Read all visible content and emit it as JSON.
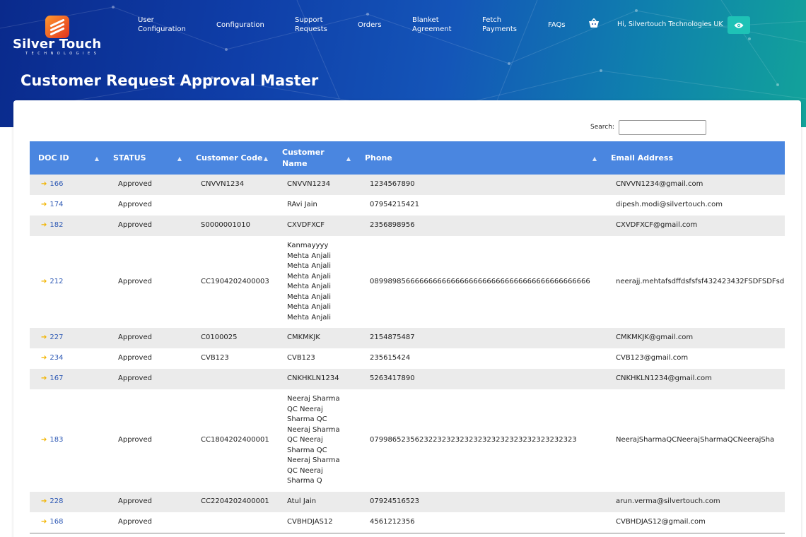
{
  "brand": {
    "name": "Silver Touch",
    "tagline": "TECHNOLOGIES"
  },
  "nav": [
    {
      "line1": "User",
      "line2": "Configuration"
    },
    {
      "line1": "Configuration",
      "line2": ""
    },
    {
      "line1": "Support",
      "line2": "Requests"
    },
    {
      "line1": "Orders",
      "line2": ""
    },
    {
      "line1": "Blanket",
      "line2": "Agreement"
    },
    {
      "line1": "Fetch",
      "line2": "Payments"
    },
    {
      "line1": "FAQs",
      "line2": ""
    }
  ],
  "icons": {
    "cart": "basket-icon",
    "view": "eye-icon",
    "sort": "sort-icon",
    "row_link": "arrow-right-icon"
  },
  "greeting": "Hi, Silvertouch Technologies UK",
  "page_title": "Customer Request Approval Master",
  "search": {
    "label": "Search:",
    "value": ""
  },
  "colors": {
    "header_bg": "#4a86e0",
    "accent": "#1ec2b6",
    "arrow": "#f2b400",
    "link": "#2f5ab5"
  },
  "table": {
    "columns": [
      {
        "label_line1": "DOC ID",
        "label_line2": ""
      },
      {
        "label_line1": "STATUS",
        "label_line2": ""
      },
      {
        "label_line1": "Customer Code",
        "label_line2": ""
      },
      {
        "label_line1": "Customer",
        "label_line2": "Name"
      },
      {
        "label_line1": "Phone",
        "label_line2": ""
      },
      {
        "label_line1": "Email Address",
        "label_line2": ""
      }
    ],
    "rows": [
      {
        "doc_id": "166",
        "status": "Approved",
        "code": "CNVVN1234",
        "name_lines": [
          "CNVVN1234"
        ],
        "phone": "1234567890",
        "email": "CNVVN1234@gmail.com"
      },
      {
        "doc_id": "174",
        "status": "Approved",
        "code": "",
        "name_lines": [
          "RAvi Jain"
        ],
        "phone": "07954215421",
        "email": "dipesh.modi@silvertouch.com"
      },
      {
        "doc_id": "182",
        "status": "Approved",
        "code": "S0000001010",
        "name_lines": [
          "CXVDFXCF"
        ],
        "phone": "2356898956",
        "email": "CXVDFXCF@gmail.com"
      },
      {
        "doc_id": "212",
        "status": "Approved",
        "code": "CC1904202400003",
        "name_lines": [
          "Kanmayyyy",
          "Mehta Anjali",
          "Mehta Anjali",
          "Mehta Anjali",
          "Mehta Anjali",
          "Mehta Anjali",
          "Mehta Anjali",
          "Mehta Anjali"
        ],
        "phone": "0899898566666666666666666666666666666666666666666",
        "email": "neerajj.mehtafsdffdsfsfsf432423432FSDFSDFsd"
      },
      {
        "doc_id": "227",
        "status": "Approved",
        "code": "C0100025",
        "name_lines": [
          "CMKMKJK"
        ],
        "phone": "2154875487",
        "email": "CMKMKJK@gmail.com"
      },
      {
        "doc_id": "234",
        "status": "Approved",
        "code": "CVB123",
        "name_lines": [
          "CVB123"
        ],
        "phone": "235615424",
        "email": "CVB123@gmail.com"
      },
      {
        "doc_id": "167",
        "status": "Approved",
        "code": "",
        "name_lines": [
          "CNKHKLN1234"
        ],
        "phone": "5263417890",
        "email": "CNKHKLN1234@gmail.com"
      },
      {
        "doc_id": "183",
        "status": "Approved",
        "code": "CC1804202400001",
        "name_lines": [
          "Neeraj Sharma",
          "QC Neeraj",
          "Sharma QC",
          "Neeraj Sharma",
          "QC Neeraj",
          "Sharma QC",
          "Neeraj Sharma",
          "QC Neeraj",
          "Sharma Q"
        ],
        "phone": "0799865235623223232323232323232323232323232323",
        "email": "NeerajSharmaQCNeerajSharmaQCNeerajSha"
      },
      {
        "doc_id": "228",
        "status": "Approved",
        "code": "CC2204202400001",
        "name_lines": [
          "Atul Jain"
        ],
        "phone": "07924516523",
        "email": "arun.verma@silvertouch.com"
      },
      {
        "doc_id": "168",
        "status": "Approved",
        "code": "",
        "name_lines": [
          "CVBHDJAS12"
        ],
        "phone": "4561212356",
        "email": "CVBHDJAS12@gmail.com"
      }
    ]
  }
}
